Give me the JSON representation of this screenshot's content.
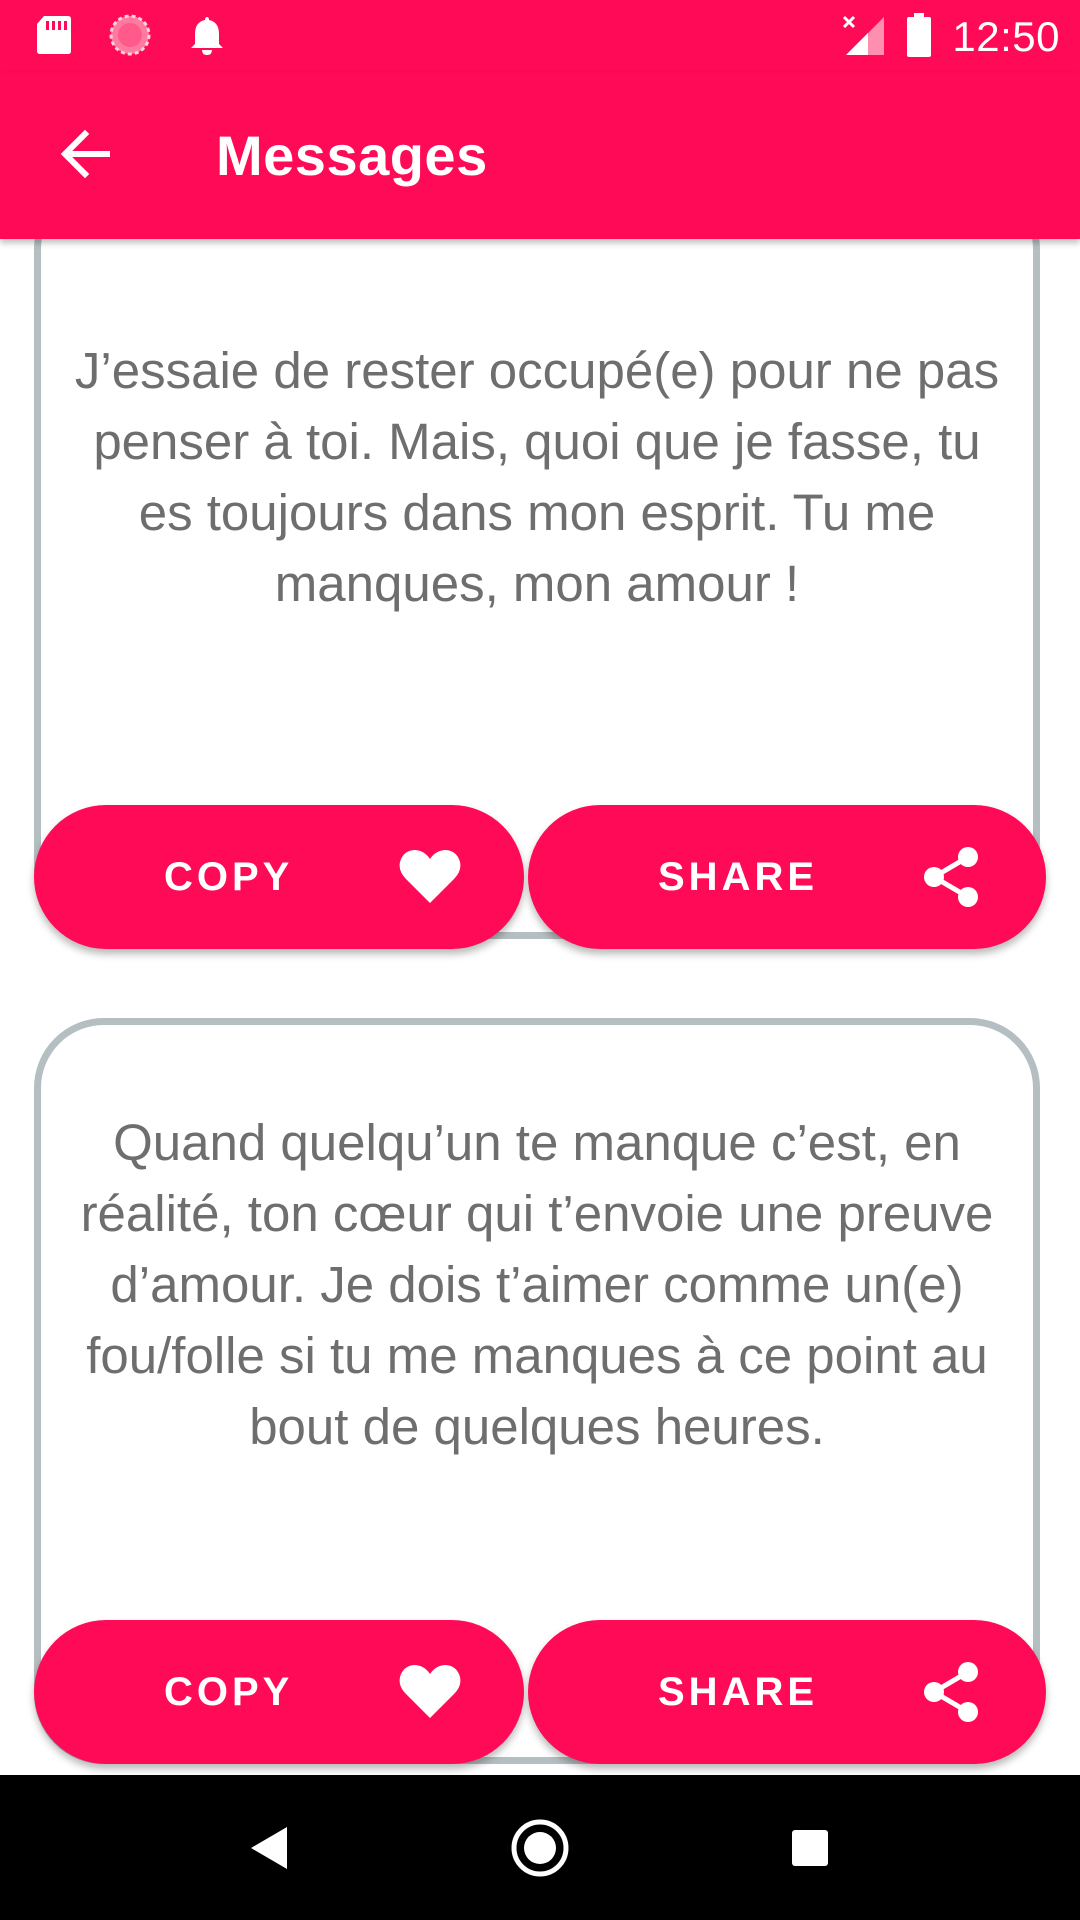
{
  "status_bar": {
    "time": "12:50",
    "left_icons": [
      "sd-card-icon",
      "loading-icon",
      "notification-bell-icon"
    ],
    "right_icons": [
      "no-signal-icon",
      "battery-icon"
    ]
  },
  "app_bar": {
    "title": "Messages",
    "back_icon": "arrow-back-icon"
  },
  "messages": [
    {
      "text": "J’essaie de rester occupé(e) pour ne pas penser à toi. Mais, quoi que je fasse, tu es toujours dans mon esprit. Tu me manques, mon amour !",
      "copy_label": "COPY",
      "share_label": "SHARE"
    },
    {
      "text": "Quand quelqu’un te manque c’est, en réalité, ton cœur qui t’envoie une preuve d’amour. Je dois t’aimer comme un(e) fou/folle si tu me manques à ce point au bout de quelques heures.",
      "copy_label": "COPY",
      "share_label": "SHARE"
    }
  ],
  "colors": {
    "accent": "#ff0a57",
    "card_border": "#b5bec0",
    "text": "#6e6e6e",
    "nav_bar": "#000000"
  },
  "nav_bar": {
    "buttons": [
      "back-triangle-icon",
      "home-circle-icon",
      "recents-square-icon"
    ]
  }
}
